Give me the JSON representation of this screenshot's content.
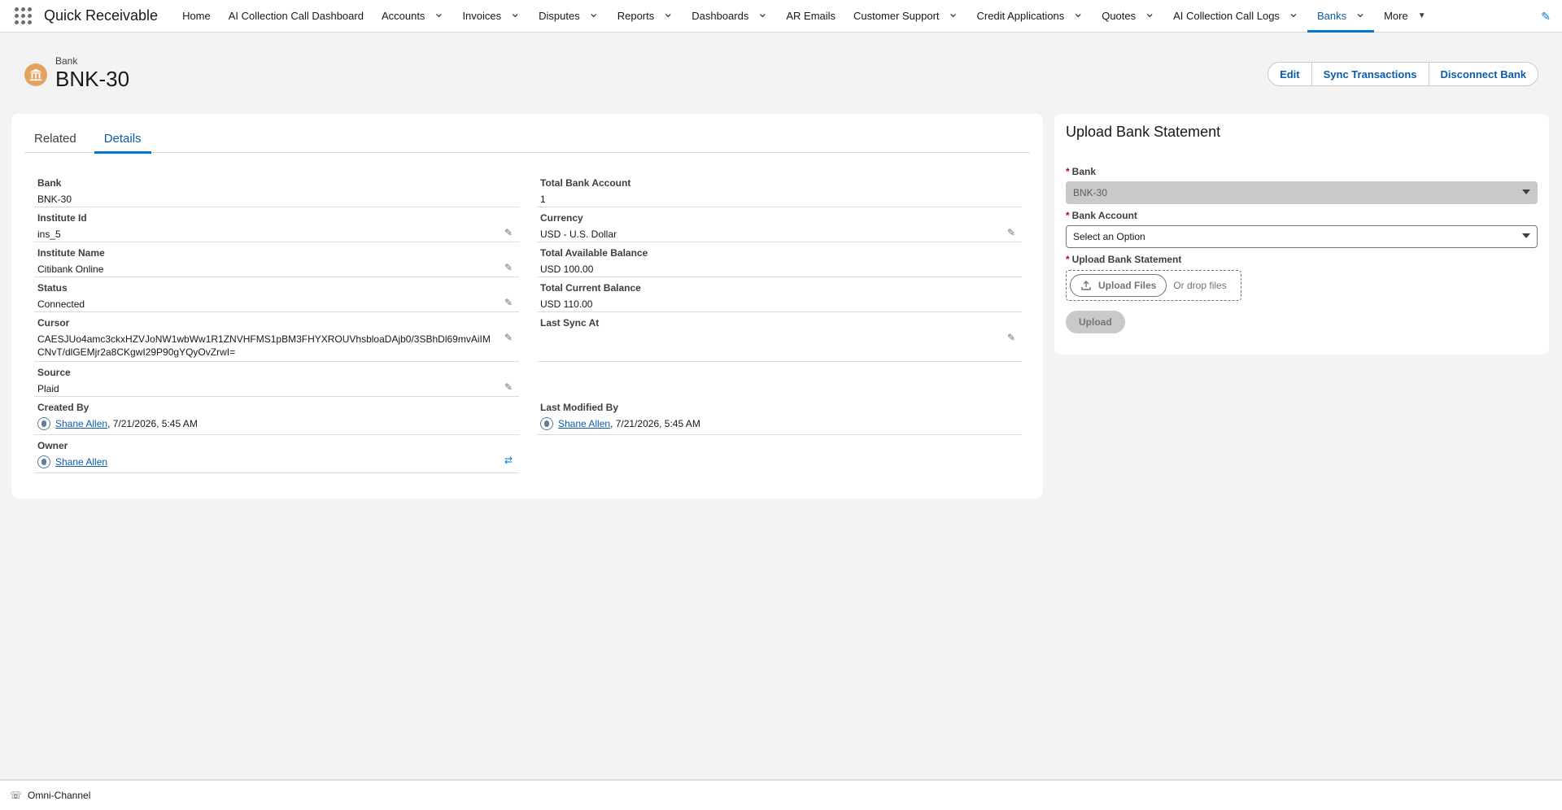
{
  "app": {
    "name": "Quick Receivable"
  },
  "nav": {
    "items": [
      {
        "label": "Home",
        "has_menu": false,
        "active": false
      },
      {
        "label": "AI Collection Call Dashboard",
        "has_menu": false,
        "active": false
      },
      {
        "label": "Accounts",
        "has_menu": true,
        "active": false
      },
      {
        "label": "Invoices",
        "has_menu": true,
        "active": false
      },
      {
        "label": "Disputes",
        "has_menu": true,
        "active": false
      },
      {
        "label": "Reports",
        "has_menu": true,
        "active": false
      },
      {
        "label": "Dashboards",
        "has_menu": true,
        "active": false
      },
      {
        "label": "AR Emails",
        "has_menu": false,
        "active": false
      },
      {
        "label": "Customer Support",
        "has_menu": true,
        "active": false
      },
      {
        "label": "Credit Applications",
        "has_menu": true,
        "active": false
      },
      {
        "label": "Quotes",
        "has_menu": true,
        "active": false
      },
      {
        "label": "AI Collection Call Logs",
        "has_menu": true,
        "active": false
      },
      {
        "label": "Banks",
        "has_menu": true,
        "active": true
      }
    ],
    "more_label": "More"
  },
  "record": {
    "type_label": "Bank",
    "title": "BNK-30",
    "actions": {
      "edit": "Edit",
      "sync": "Sync Transactions",
      "disconnect": "Disconnect Bank"
    }
  },
  "tabs": {
    "related": "Related",
    "details": "Details"
  },
  "details": {
    "bank": {
      "label": "Bank",
      "value": "BNK-30"
    },
    "institute_id": {
      "label": "Institute Id",
      "value": "ins_5"
    },
    "institute_name": {
      "label": "Institute Name",
      "value": "Citibank Online"
    },
    "status": {
      "label": "Status",
      "value": "Connected"
    },
    "cursor": {
      "label": "Cursor",
      "value": "CAESJUo4amc3ckxHZVJoNW1wbWw1R1ZNVHFMS1pBM3FHYXROUVhsbloaDAjb0/3SBhDl69mvAiIMCNvT/dlGEMjr2a8CKgwI29P90gYQyOvZrwI="
    },
    "source": {
      "label": "Source",
      "value": "Plaid"
    },
    "created_by": {
      "label": "Created By",
      "user": "Shane Allen",
      "date": ", 7/21/2026, 5:45 AM"
    },
    "owner": {
      "label": "Owner",
      "user": "Shane Allen"
    },
    "total_bank_account": {
      "label": "Total Bank Account",
      "value": "1"
    },
    "currency": {
      "label": "Currency",
      "value": "USD - U.S. Dollar"
    },
    "total_available_balance": {
      "label": "Total Available Balance",
      "value": "USD 100.00"
    },
    "total_current_balance": {
      "label": "Total Current Balance",
      "value": "USD 110.00"
    },
    "last_sync_at": {
      "label": "Last Sync At",
      "value": ""
    },
    "last_modified_by": {
      "label": "Last Modified By",
      "user": "Shane Allen",
      "date": ", 7/21/2026, 5:45 AM"
    }
  },
  "upload": {
    "title": "Upload Bank Statement",
    "bank_label": "Bank",
    "bank_value": "BNK-30",
    "bank_account_label": "Bank Account",
    "bank_account_placeholder": "Select an Option",
    "statement_label": "Upload Bank Statement",
    "upload_files_label": "Upload Files",
    "or_drop_label": "Or drop files",
    "upload_button": "Upload"
  },
  "footer": {
    "omni_channel": "Omni-Channel"
  },
  "colors": {
    "brand": "#0176d3",
    "link": "#0b5cab",
    "bank_icon_bg": "#e3a35f",
    "required": "#ba0517"
  }
}
